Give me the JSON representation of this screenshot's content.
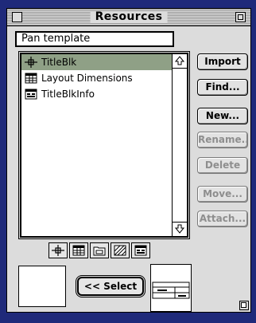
{
  "window": {
    "title": "Resources"
  },
  "template_field": {
    "value": "Pan template"
  },
  "list": {
    "items": [
      {
        "label": "TitleBlk",
        "icon": "crosshair-icon",
        "selected": true
      },
      {
        "label": "Layout Dimensions",
        "icon": "table-icon",
        "selected": false
      },
      {
        "label": "TitleBlkInfo",
        "icon": "titleblock-info-icon",
        "selected": false
      }
    ]
  },
  "buttons": {
    "import": "Import",
    "find": "Find...",
    "new": "New...",
    "rename": "Rename...",
    "delete": "Delete",
    "move": "Move...",
    "attach": "Attach..."
  },
  "select_button": {
    "label": "<< Select"
  },
  "type_bar": {
    "icons": [
      "crosshair-icon",
      "table-icon",
      "folder-icon",
      "hatch-icon",
      "titleblock-info-icon"
    ]
  },
  "colors": {
    "selection": "#8fa086",
    "desktop": "#1f2a7a",
    "window": "#dcdcdc"
  }
}
